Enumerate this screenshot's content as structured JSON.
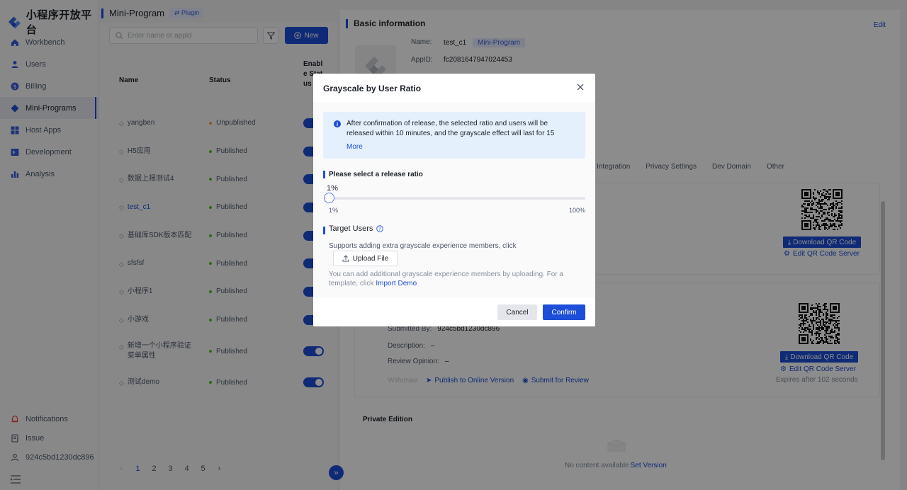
{
  "app": {
    "title": "小程序开放平台"
  },
  "header": {
    "name": "Mini-Program",
    "plugin_badge": "⇄ Plugin"
  },
  "sidebar": {
    "items": [
      {
        "label": "Workbench",
        "icon": "home-icon",
        "active": false
      },
      {
        "label": "Users",
        "icon": "user-icon",
        "active": false
      },
      {
        "label": "Billing",
        "icon": "billing-icon",
        "active": false
      },
      {
        "label": "Mini-Programs",
        "icon": "miniprogram-icon",
        "active": true
      },
      {
        "label": "Host Apps",
        "icon": "grid-icon",
        "active": false
      },
      {
        "label": "Development",
        "icon": "terminal-icon",
        "active": false
      },
      {
        "label": "Analysis",
        "icon": "chart-icon",
        "active": false
      }
    ],
    "bottom": [
      {
        "label": "Notifications",
        "icon": "bell-icon"
      },
      {
        "label": "Issue",
        "icon": "document-icon"
      },
      {
        "label": "924c5bd1230dc896",
        "icon": "account-icon"
      }
    ]
  },
  "list": {
    "search_placeholder": "Enter name or appid",
    "new_label": "New",
    "columns": {
      "name": "Name",
      "status": "Status",
      "enable": "Enable Status"
    },
    "rows": [
      {
        "name": "yangben",
        "status": "Unpublished",
        "status_color": "#f7a23b",
        "enabled": true
      },
      {
        "name": "H5应用",
        "status": "Published",
        "status_color": "#52c41a",
        "enabled": true
      },
      {
        "name": "数据上报测试4",
        "status": "Published",
        "status_color": "#52c41a",
        "enabled": true
      },
      {
        "name": "test_c1",
        "status": "Published",
        "status_color": "#52c41a",
        "enabled": true,
        "selected": true
      },
      {
        "name": "基础库SDK版本匹配",
        "status": "Published",
        "status_color": "#52c41a",
        "enabled": true
      },
      {
        "name": "sfsfsf",
        "status": "Published",
        "status_color": "#52c41a",
        "enabled": true
      },
      {
        "name": "小程序1",
        "status": "Published",
        "status_color": "#52c41a",
        "enabled": true
      },
      {
        "name": "小游戏",
        "status": "Published",
        "status_color": "#52c41a",
        "enabled": true
      },
      {
        "name": "新增一个小程序验证菜单属性",
        "status": "Published",
        "status_color": "#52c41a",
        "enabled": true
      },
      {
        "name": "测试demo",
        "status": "Published",
        "status_color": "#52c41a",
        "enabled": true
      }
    ],
    "pages": [
      "1",
      "2",
      "3",
      "4",
      "5"
    ],
    "current_page": "1",
    "prev": "‹",
    "next": "›"
  },
  "detail": {
    "section_title": "Basic information",
    "edit_label": "Edit",
    "name_label": "Name:",
    "name_value": "test_c1",
    "type_badge": "Mini-Program",
    "appid_label": "AppID:",
    "appid_value": "fc2081647947024453",
    "tabs": [
      "Integration",
      "Privacy Settings",
      "Dev Domain",
      "Other"
    ],
    "download_qr": "Download QR Code",
    "edit_qr_server": "Edit QR Code Server",
    "submitted_by_label": "Submitted By:",
    "submitted_by_value": "924c5bd1230dc896",
    "description_label": "Description:",
    "description_value": "–",
    "review_label": "Review Opinion:",
    "review_value": "–",
    "withdraw": "Withdraw",
    "publish_online": "Publish to Online Version",
    "submit_review": "Submit for Review",
    "expire_text": "Expires after 102 seconds",
    "private_title": "Private Edition",
    "empty_text": "No content available",
    "set_version": "Set Version"
  },
  "modal": {
    "title": "Grayscale by User Ratio",
    "alert_text": "After confirmation of release, the selected ratio and users will be released within 10 minutes, and the grayscale effect will last for 15",
    "alert_more": "More",
    "ratio_label": "Please select a release ratio",
    "ratio_value": "1%",
    "ratio_percent": 1,
    "slider_min": "1%",
    "slider_max": "100%",
    "target_label": "Target Users",
    "support_text": "Supports adding extra grayscale experience members, click",
    "upload_label": "Upload File",
    "upload_hint": "You can add additional grayscale experience members by uploading. For a template, click",
    "import_demo": "Import Demo",
    "cancel": "Cancel",
    "confirm": "Confirm"
  }
}
